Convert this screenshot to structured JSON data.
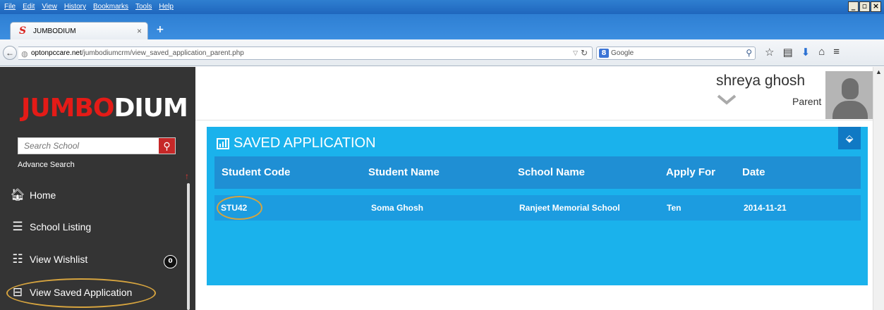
{
  "browser": {
    "menus": [
      "File",
      "Edit",
      "View",
      "History",
      "Bookmarks",
      "Tools",
      "Help"
    ],
    "tab_title": "JUMBODIUM",
    "url_domain": "optonpccare.net",
    "url_path": "/jumbodiumcrm/view_saved_application_parent.php",
    "search_engine": "Google"
  },
  "sidebar": {
    "logo_red": "JUMBO",
    "logo_white": "DIUM",
    "search_placeholder": "Search School",
    "advance_search": "Advance Search",
    "items": [
      {
        "label": "Home",
        "icon": "home-icon"
      },
      {
        "label": "School Listing",
        "icon": "list-icon"
      },
      {
        "label": "View Wishlist",
        "icon": "wishlist-icon",
        "badge": "0"
      },
      {
        "label": "View Saved Application",
        "icon": "inbox-icon"
      }
    ]
  },
  "user": {
    "name": "shreya ghosh",
    "role": "Parent"
  },
  "panel": {
    "title": "SAVED APPLICATION",
    "columns": [
      "Student Code",
      "Student Name",
      "School Name",
      "Apply For",
      "Date"
    ],
    "rows": [
      {
        "student_code": "STU42",
        "student_name": "Soma Ghosh",
        "school_name": "Ranjeet Memorial School",
        "apply_for": "Ten",
        "date": "2014-11-21"
      }
    ]
  },
  "colors": {
    "panel_bg": "#1ab2ec",
    "header_bg": "#1f8fd4",
    "sidebar_bg": "#343434",
    "highlight_oval": "#d6a43f",
    "logo_red": "#e41b17"
  }
}
